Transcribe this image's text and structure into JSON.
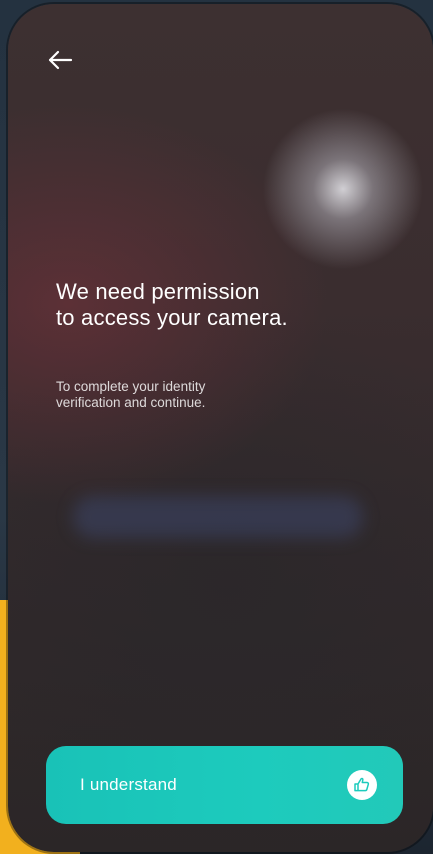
{
  "colors": {
    "accent": "#1dcbbd",
    "text": "#ffffff",
    "backdrop_accent": "#f2b01e"
  },
  "header": {
    "back_icon": "arrow-left-icon"
  },
  "permission": {
    "headline_line1": "We need permission",
    "headline_line2": "to access your camera.",
    "subtext_line1": "To complete your identity",
    "subtext_line2": "verification and continue."
  },
  "cta": {
    "label": "I understand",
    "icon": "thumbs-up-icon"
  }
}
